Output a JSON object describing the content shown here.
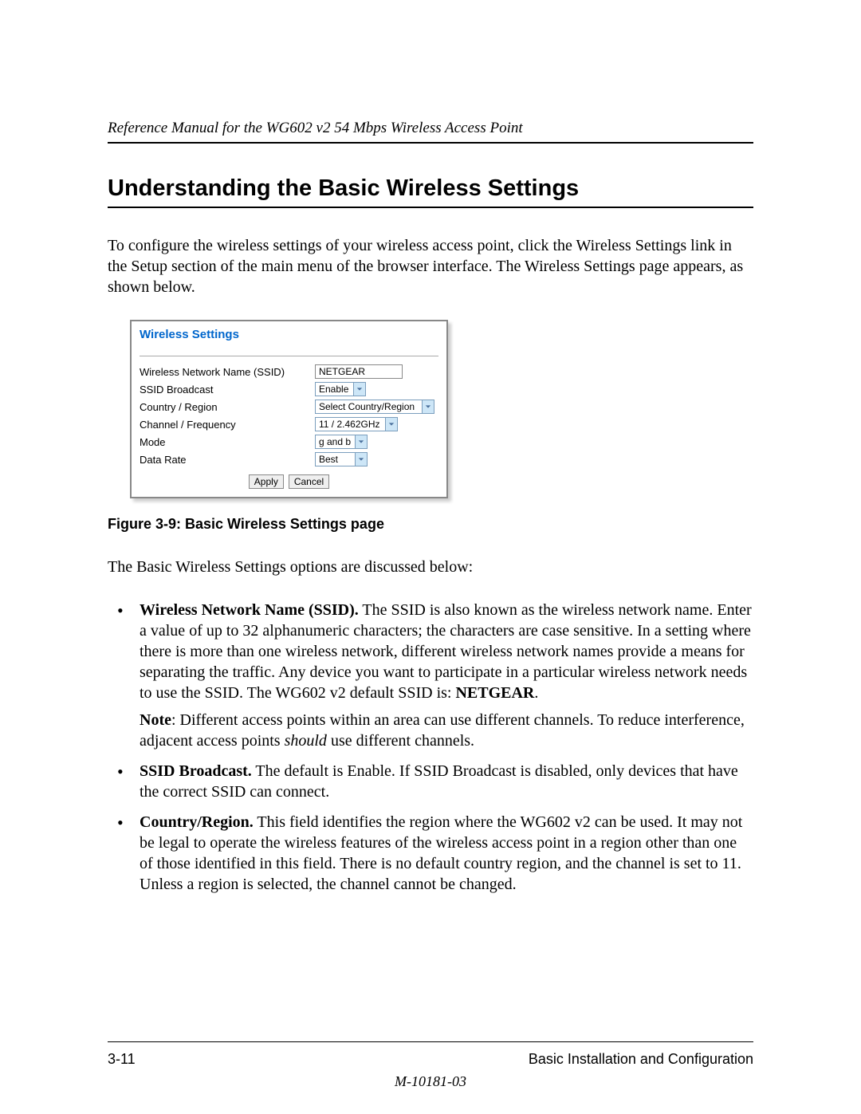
{
  "header": "Reference Manual for the WG602 v2 54 Mbps Wireless Access Point",
  "section_title": "Understanding the Basic Wireless Settings",
  "intro": "To configure the wireless settings of your wireless access point, click the Wireless Settings link in the Setup section of the main menu of the browser interface. The Wireless Settings page appears, as shown below.",
  "figure": {
    "panel_title": "Wireless Settings",
    "rows": {
      "ssid_label": "Wireless Network Name (SSID)",
      "ssid_value": "NETGEAR",
      "broadcast_label": "SSID Broadcast",
      "broadcast_value": "Enable",
      "country_label": "Country / Region",
      "country_value": "Select Country/Region",
      "channel_label": "Channel / Frequency",
      "channel_value": "11 / 2.462GHz",
      "mode_label": "Mode",
      "mode_value": "g and b",
      "rate_label": "Data Rate",
      "rate_value": "Best"
    },
    "apply_label": "Apply",
    "cancel_label": "Cancel",
    "caption": "Figure 3-9: Basic Wireless Settings page"
  },
  "lead": "The Basic Wireless Settings options are discussed below:",
  "bullets": {
    "b1_strong": "Wireless Network Name (SSID).",
    "b1_text": " The SSID is also known as the wireless network name. Enter a value of up to 32 alphanumeric characters; the characters are case sensitive. In a setting where there is more than one wireless network, different wireless network names provide a means for separating the traffic. Any device you want to participate in a particular wireless network needs to use the SSID. The WG602 v2 default SSID is: ",
    "b1_tail_strong": "NETGEAR",
    "b1_tail": ".",
    "b1_note_bold": "Note",
    "b1_note_a": ": Different access points within an area can use different channels. To reduce interference, adjacent access points ",
    "b1_note_em": "should",
    "b1_note_b": " use different channels.",
    "b2_strong": "SSID Broadcast.",
    "b2_text": " The default is Enable. If SSID Broadcast is disabled, only devices that have the correct SSID can connect.",
    "b3_strong": "Country/Region.",
    "b3_text": " This field identifies the region where the WG602 v2 can be used. It may not be legal to operate the wireless features of the wireless access point in a region other than one of those identified in this field. There is no default country region, and the channel is set to 11. Unless a region is selected, the channel cannot be changed."
  },
  "footer": {
    "page": "3-11",
    "chapter": "Basic Installation and Configuration",
    "doc_id": "M-10181-03"
  }
}
